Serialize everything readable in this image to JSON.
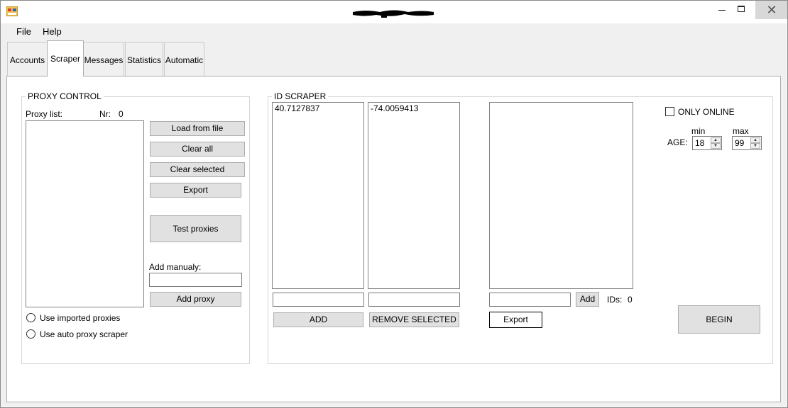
{
  "window": {
    "title_redacted": true,
    "controls": {
      "minimize": "–",
      "maximize": "□",
      "close": "✕"
    }
  },
  "menu": {
    "file": "File",
    "help": "Help"
  },
  "tabs": [
    {
      "label": "Accounts"
    },
    {
      "label": "Scraper"
    },
    {
      "label": "Messages"
    },
    {
      "label": "Statistics"
    },
    {
      "label": "Automatic"
    }
  ],
  "proxy_control": {
    "title": "PROXY CONTROL",
    "proxy_list_label": "Proxy list:",
    "nr_label": "Nr:",
    "nr_value": "0",
    "load_from_file": "Load from file",
    "clear_all": "Clear all",
    "clear_selected": "Clear selected",
    "export": "Export",
    "test_proxies": "Test proxies",
    "add_manually_label": "Add manualy:",
    "add_manually_value": "",
    "add_proxy": "Add proxy",
    "use_imported": "Use imported proxies",
    "use_auto": "Use auto proxy scraper"
  },
  "id_scraper": {
    "title": "ID SCRAPER",
    "list1_item": "40.7127837",
    "list2_item": "-74.0059413",
    "input1_value": "",
    "input2_value": "",
    "add": "ADD",
    "remove_selected": "REMOVE SELECTED",
    "ids_input_value": "",
    "add_small": "Add",
    "ids_label": "IDs:",
    "ids_value": "0",
    "export": "Export",
    "only_online": "ONLY ONLINE",
    "age_label": "AGE:",
    "min_label": "min",
    "max_label": "max",
    "min_value": "18",
    "max_value": "99",
    "begin": "BEGIN"
  },
  "colors": {
    "chrome": "#f0f0f0",
    "close_button": "#d8d8d8",
    "button_face": "#e1e1e1",
    "icon_yellow": "#f2c14e",
    "icon_red": "#d04030"
  }
}
